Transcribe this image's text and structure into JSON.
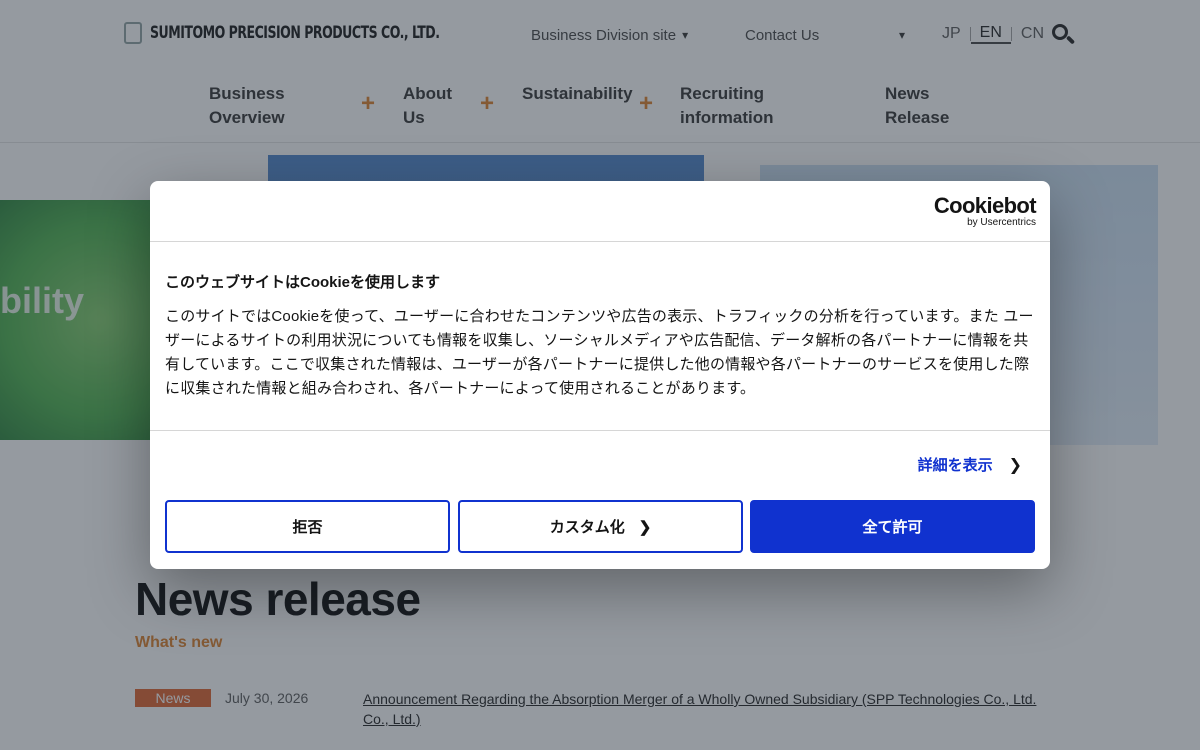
{
  "header": {
    "logo_text": "SUMITOMO PRECISION PRODUCTS CO., LTD.",
    "division_select": "Business Division site",
    "contact_select": "Contact Us",
    "languages": [
      "JP",
      "EN",
      "CN"
    ]
  },
  "nav": {
    "business_overview": "Business Overview",
    "about_us": "About Us",
    "sustainability": "Sustainability",
    "recruiting": "Recruiting information",
    "news_release": "News Release",
    "expand_symbol": "+"
  },
  "hero": {
    "partial_word": "bility"
  },
  "news": {
    "title": "News release",
    "subtitle": "What's new",
    "items": [
      {
        "badge": "News",
        "date": "July 30, 2026",
        "headline": "Announcement Regarding the Absorption Merger of a Wholly Owned Subsidiary (SPP Technologies Co., Ltd. Co., Ltd.)"
      }
    ]
  },
  "cookie_dialog": {
    "brand": "Cookiebot",
    "brand_sub": "by Usercentrics",
    "title": "このウェブサイトはCookieを使用します",
    "body": "このサイトではCookieを使って、ユーザーに合わせたコンテンツや広告の表示、トラフィックの分析を行っています。また ユーザーによるサイトの利用状況についても情報を収集し、ソーシャルメディアや広告配信、データ解析の各パートナーに情報を共有しています。ここで収集された情報は、ユーザーが各パートナーに提供した他の情報や各パートナーのサービスを使用した際に収集された情報と組み合わされ、各パートナーによって使用されることがあります。",
    "details_link": "詳細を表示",
    "deny_button": "拒否",
    "customize_button": "カスタム化",
    "allow_all_button": "全て許可"
  },
  "colors": {
    "accent_blue": "#1032cf",
    "accent_orange": "#e08a3c",
    "overlay": "rgba(20,30,45,0.45)"
  }
}
